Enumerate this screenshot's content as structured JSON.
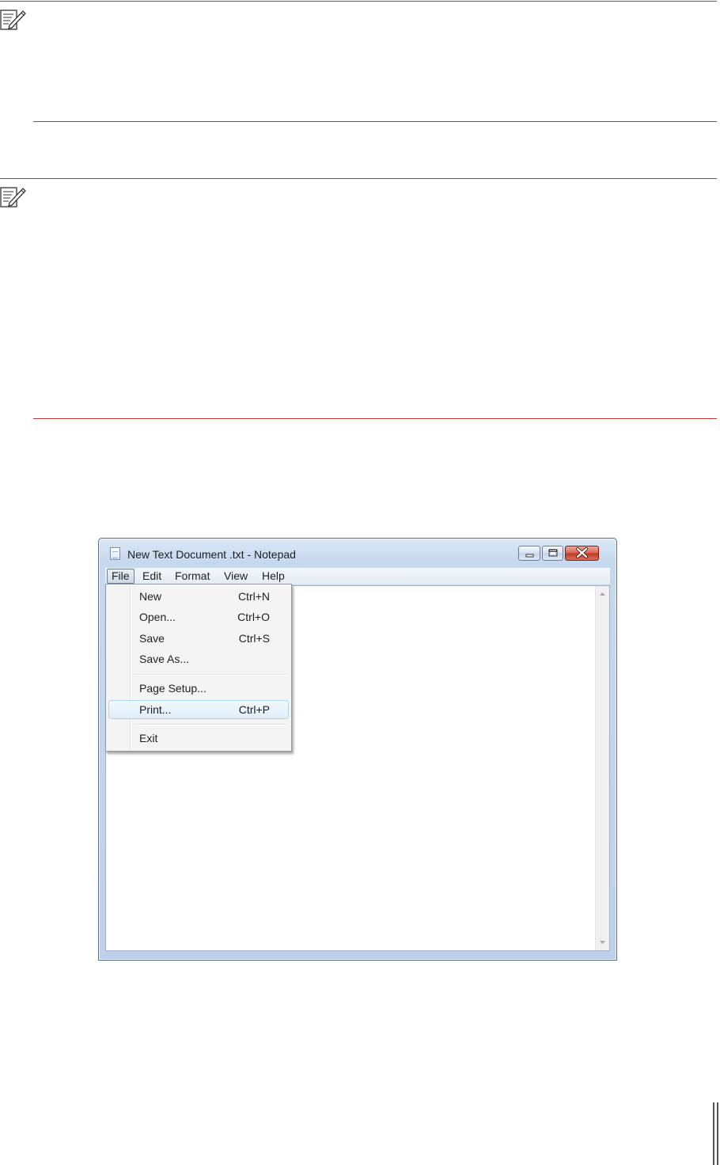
{
  "notepad": {
    "title": "New Text Document .txt - Notepad",
    "menu": {
      "file": "File",
      "edit": "Edit",
      "format": "Format",
      "view": "View",
      "help": "Help"
    },
    "file_menu": [
      {
        "label": "New",
        "shortcut": "Ctrl+N"
      },
      {
        "label": "Open...",
        "shortcut": "Ctrl+O"
      },
      {
        "label": "Save",
        "shortcut": "Ctrl+S"
      },
      {
        "label": "Save As...",
        "shortcut": ""
      },
      {
        "label": "Page Setup...",
        "shortcut": ""
      },
      {
        "label": "Print...",
        "shortcut": "Ctrl+P"
      },
      {
        "label": "Exit",
        "shortcut": ""
      }
    ],
    "highlighted_item": "Print..."
  },
  "icons": {
    "note_top": "note-pencil-icon",
    "note_second": "note-pencil-icon",
    "window_minimize": "minimize-icon",
    "window_maximize": "maximize-icon",
    "window_close": "close-icon"
  },
  "colors": {
    "rule": "#c8372f",
    "highlight": "#dfeef8",
    "close_button": "#c3361f"
  }
}
